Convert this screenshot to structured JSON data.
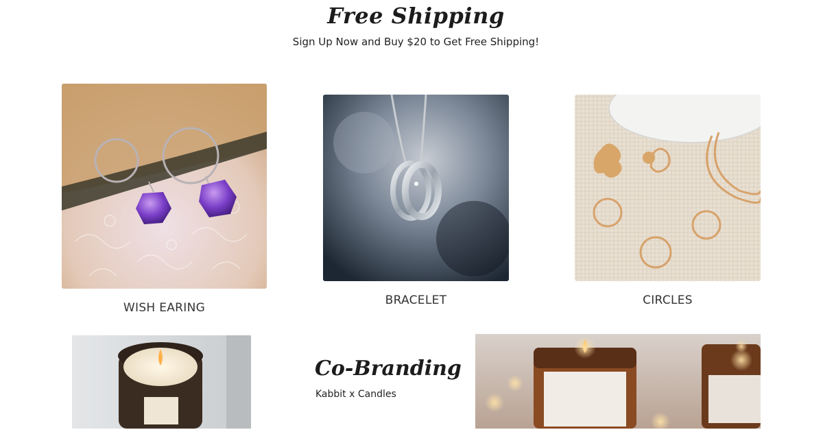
{
  "banner": {
    "title": "Free Shipping",
    "subtitle": "Sign Up Now and Buy $20 to Get Free Shipping!"
  },
  "products": [
    {
      "label": "WISH EARING",
      "image": "amethyst-hoop-earrings-photo"
    },
    {
      "label": "BRACELET",
      "image": "silver-ring-pendant-photo"
    },
    {
      "label": "CIRCLES",
      "image": "gold-rings-and-earrings-photo"
    }
  ],
  "cobranding": {
    "title": "Co-Branding",
    "subtitle": "Kabbit x Candles",
    "left_image": "candle-jar-photo",
    "right_image": "amber-candles-photo"
  },
  "colors": {
    "text": "#222222",
    "background": "#ffffff"
  }
}
